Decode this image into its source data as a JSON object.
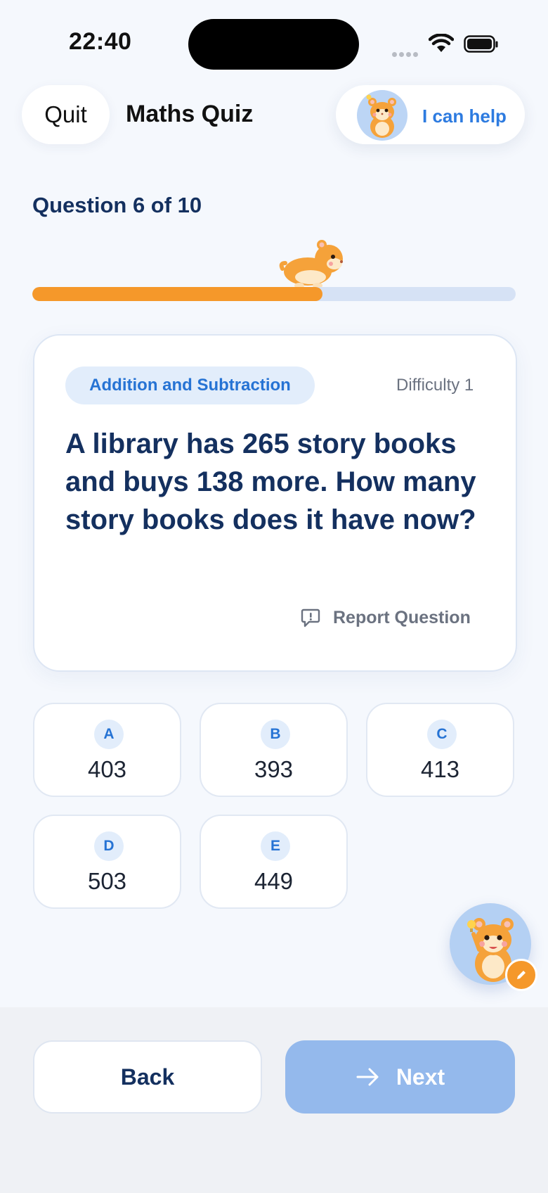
{
  "status_bar": {
    "time": "22:40"
  },
  "header": {
    "quit_label": "Quit",
    "title": "Maths Quiz",
    "help_label": "I can help"
  },
  "progress": {
    "label": "Question 6 of 10",
    "current": 6,
    "total": 10,
    "fraction": 0.6
  },
  "question": {
    "topic": "Addition and Subtraction",
    "difficulty": "Difficulty 1",
    "text": "A library has 265 story books and buys 138 more. How many story books does it have now?",
    "report_label": "Report Question"
  },
  "options": [
    {
      "letter": "A",
      "value": "403"
    },
    {
      "letter": "B",
      "value": "393"
    },
    {
      "letter": "C",
      "value": "413"
    },
    {
      "letter": "D",
      "value": "503"
    },
    {
      "letter": "E",
      "value": "449"
    }
  ],
  "footer": {
    "back_label": "Back",
    "next_label": "Next"
  },
  "colors": {
    "accent_orange": "#f5982a",
    "accent_blue": "#2673d4",
    "next_disabled": "#94b9ec",
    "title_navy": "#14305f"
  },
  "icons": {
    "help_avatar": "hamster-mascot-icon",
    "runner": "running-hamster-icon",
    "report": "report-flag-icon",
    "fab": "hamster-helper-icon",
    "fab_badge": "pencil-icon",
    "next": "arrow-right-icon"
  }
}
